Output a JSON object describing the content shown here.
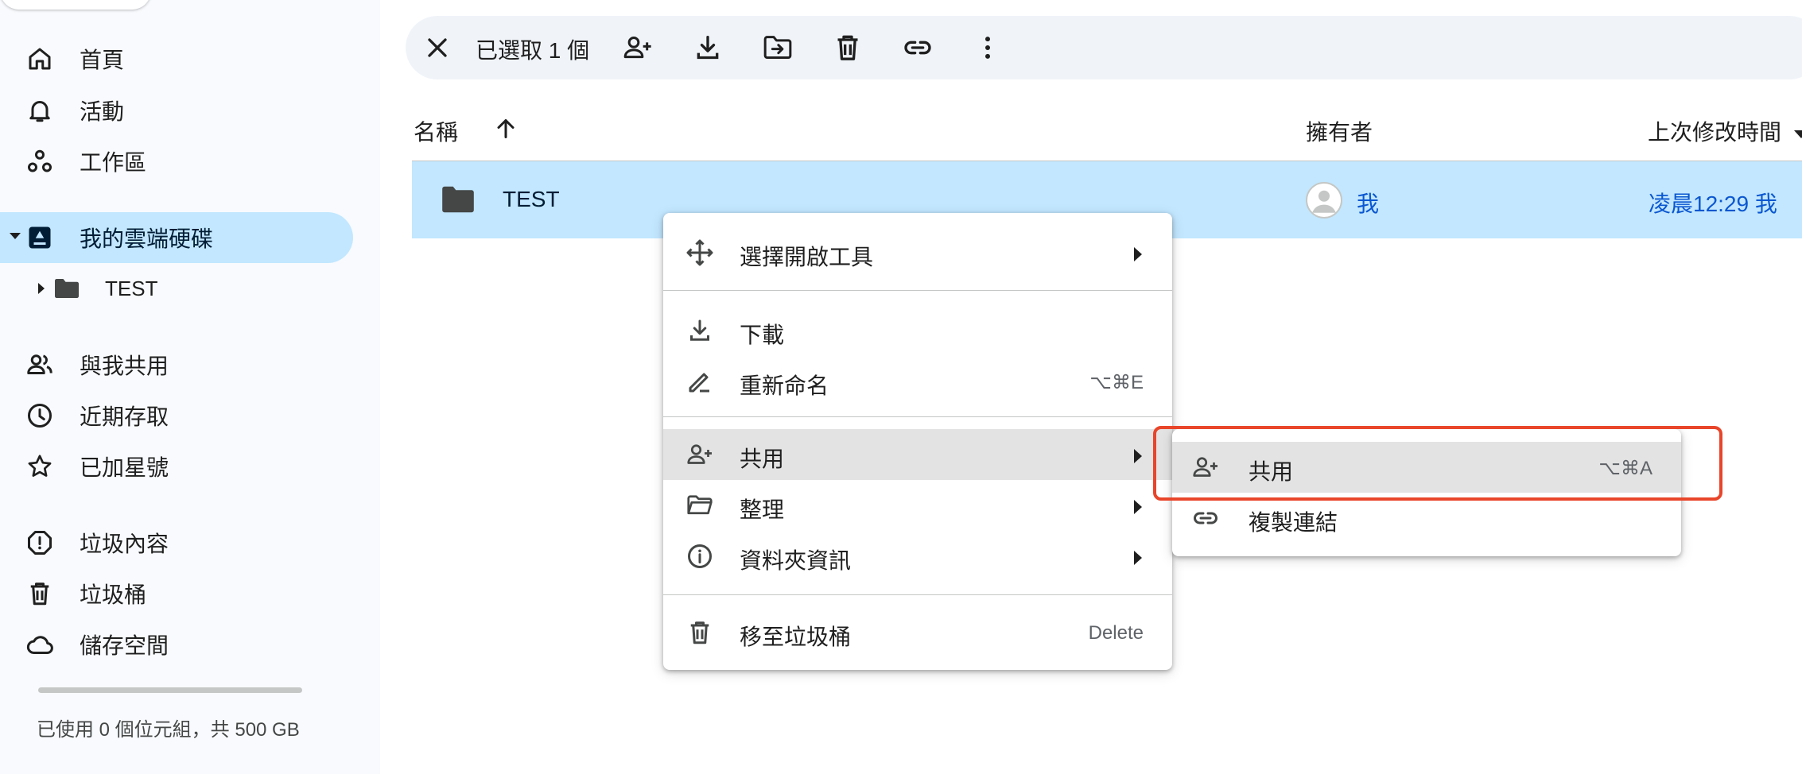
{
  "sidebar": {
    "items": [
      {
        "label": "首頁",
        "icon": "home-icon"
      },
      {
        "label": "活動",
        "icon": "bell-icon"
      },
      {
        "label": "工作區",
        "icon": "workspaces-icon"
      },
      {
        "label": "我的雲端硬碟",
        "icon": "drive-icon"
      },
      {
        "label": "TEST",
        "icon": "folder-icon"
      },
      {
        "label": "與我共用",
        "icon": "people-icon"
      },
      {
        "label": "近期存取",
        "icon": "clock-icon"
      },
      {
        "label": "已加星號",
        "icon": "star-icon"
      },
      {
        "label": "垃圾內容",
        "icon": "spam-icon"
      },
      {
        "label": "垃圾桶",
        "icon": "trash-icon"
      },
      {
        "label": "儲存空間",
        "icon": "cloud-icon"
      }
    ],
    "storage_text": "已使用 0 個位元組，共 500 GB",
    "storage_used_fraction": 0.0
  },
  "toolbar": {
    "selected_count": "已選取 1 個",
    "actions": [
      "close-icon",
      "share-icon",
      "download-icon",
      "move-icon",
      "trash-icon",
      "link-icon",
      "more-vert-icon"
    ]
  },
  "columns": {
    "name": "名稱",
    "owner": "擁有者",
    "modified": "上次修改時間"
  },
  "files": [
    {
      "name": "TEST",
      "owner": "我",
      "modified": "凌晨12:29 我",
      "selected": true
    }
  ],
  "context_menu": {
    "items": [
      {
        "label": "選擇開啟工具",
        "icon": "open-with-icon",
        "submenu": true
      },
      {
        "label": "下載",
        "icon": "download-icon"
      },
      {
        "label": "重新命名",
        "icon": "rename-icon",
        "shortcut": "⌥⌘E"
      },
      {
        "label": "共用",
        "icon": "share-icon",
        "submenu": true,
        "active": true
      },
      {
        "label": "整理",
        "icon": "organize-icon",
        "submenu": true
      },
      {
        "label": "資料夾資訊",
        "icon": "info-icon",
        "submenu": true
      },
      {
        "label": "移至垃圾桶",
        "icon": "trash-icon",
        "shortcut": "Delete"
      }
    ]
  },
  "share_submenu": {
    "items": [
      {
        "label": "共用",
        "icon": "share-icon",
        "shortcut": "⌥⌘A",
        "hover": true
      },
      {
        "label": "複製連結",
        "icon": "link-icon"
      }
    ]
  },
  "colors": {
    "selection": "#c2e7ff",
    "accent": "#0b57d0",
    "highlight": "#e8452a",
    "hover": "#e3e3e3"
  }
}
